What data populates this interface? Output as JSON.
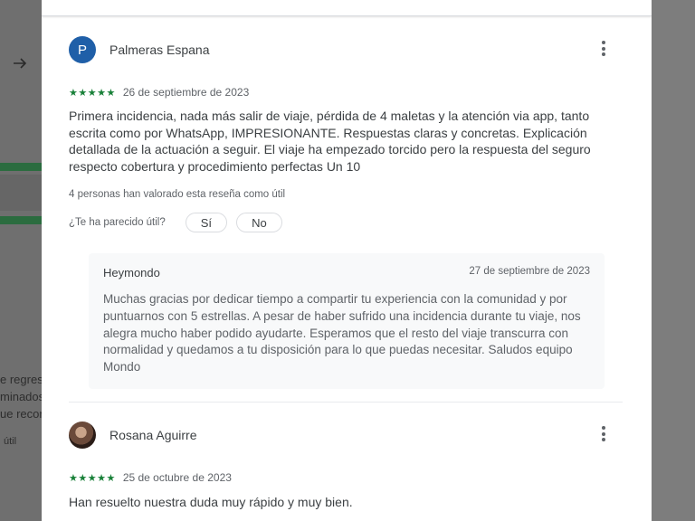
{
  "background": {
    "snippets": [
      "e regres",
      "minados",
      "ue recor",
      "útil"
    ],
    "arrow_icon": "arrow-right-icon",
    "accent_bar_color": "#2b6c3f"
  },
  "reviews": [
    {
      "author": "Palmeras Espana",
      "avatar_letter": "P",
      "avatar_color": "#1f5fa8",
      "stars": "★★★★★",
      "rating": 5,
      "date": "26 de septiembre de 2023",
      "text": "Primera incidencia, nada más salir de viaje, pérdida de 4 maletas y la atención via app, tanto escrita como por WhatsApp, IMPRESIONANTE. Respuestas claras y concretas. Explicación detallada de la actuación a seguir. El viaje ha empezado torcido pero la respuesta del seguro respecto cobertura y procedimiento perfectas Un 10",
      "helpful_count": "4 personas han valorado esta reseña como útil",
      "helpful_question": "¿Te ha parecido útil?",
      "yes_label": "Sí",
      "no_label": "No",
      "reply": {
        "author": "Heymondo",
        "date": "27 de septiembre de 2023",
        "text": "Muchas gracias por dedicar tiempo a compartir tu experiencia con la comunidad y por puntuarnos con 5 estrellas. A pesar de haber sufrido una incidencia durante tu viaje, nos alegra mucho haber podido ayudarte. Esperamos que el resto del viaje transcurra con normalidad y quedamos a tu disposición para lo que puedas necesitar. Saludos equipo Mondo"
      }
    },
    {
      "author": "Rosana Aguirre",
      "stars": "★★★★★",
      "rating": 5,
      "date": "25 de octubre de 2023",
      "text": "Han resuelto nuestra duda muy rápido y muy bien."
    }
  ],
  "colors": {
    "star": "#188038",
    "text": "#3c4043",
    "muted": "#5f6368"
  }
}
